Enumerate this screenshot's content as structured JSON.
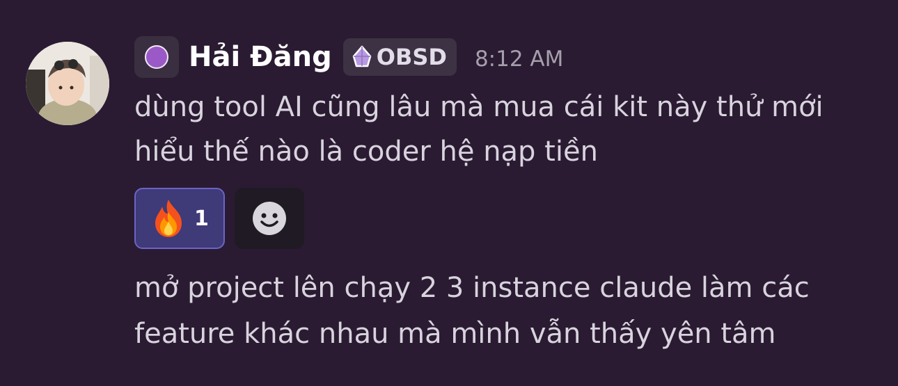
{
  "message": {
    "author": "Hải Đăng",
    "tag": "OBSD",
    "timestamp": "8:12 AM",
    "lines": [
      "dùng tool AI cũng lâu mà mua cái kit này thử mới",
      "hiểu thế nào là coder hệ nạp tiền"
    ],
    "reaction": {
      "emoji_icon": "fire-icon",
      "count": "1"
    },
    "add_reaction_icon": "smiley-icon",
    "followup_lines": [
      "mở project lên chạy 2 3 instance claude làm các",
      "feature khác nhau mà mình vẫn thấy yên tâm"
    ]
  },
  "colors": {
    "background": "#2a1b32",
    "role_dot": "#9b59c7",
    "reaction_bg": "#3f3a78",
    "reaction_border": "#6d64c7",
    "tag_gem": "#b89ae0"
  }
}
